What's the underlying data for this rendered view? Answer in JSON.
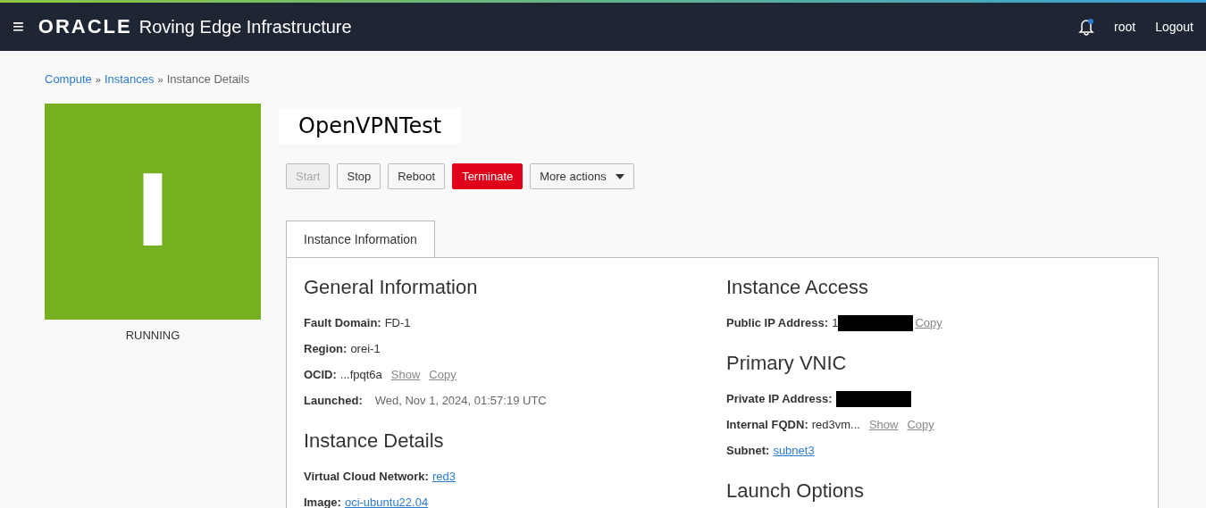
{
  "header": {
    "menu_glyph": "≡",
    "brand": "ORACLE",
    "product": "Roving Edge Infrastructure",
    "notification_unread": true,
    "user": "root",
    "logout": "Logout"
  },
  "breadcrumbs": [
    {
      "label": "Compute",
      "kind": "link"
    },
    {
      "label": "Instances",
      "kind": "link"
    },
    {
      "label": "Instance Details",
      "kind": "current"
    }
  ],
  "breadcrumb_separator": "»",
  "status": {
    "letter": "I",
    "label": "RUNNING",
    "color": "#76b021"
  },
  "title": "OpenVPNTest",
  "actions": [
    {
      "label": "Start",
      "kind": "default",
      "disabled": true
    },
    {
      "label": "Stop",
      "kind": "default",
      "disabled": false
    },
    {
      "label": "Reboot",
      "kind": "default",
      "disabled": false
    },
    {
      "label": "Terminate",
      "kind": "danger",
      "disabled": false
    },
    {
      "label": "More actions",
      "kind": "menu",
      "disabled": false
    }
  ],
  "tabs": [
    {
      "label": "Instance Information",
      "selected": true
    }
  ],
  "columns": [
    {
      "sections": [
        {
          "heading": "General Information",
          "fields": [
            {
              "label": "Fault Domain:",
              "value": "FD-1",
              "kind": "text"
            },
            {
              "label": "Region:",
              "value": "orei-1",
              "kind": "text"
            },
            {
              "label": "OCID:",
              "value": "...fpqt6a",
              "kind": "text",
              "actions": [
                "Show",
                "Copy"
              ]
            },
            {
              "label": "Launched:",
              "value": "Wed, Nov 1, 2024, 01:57:19 UTC",
              "kind": "muted"
            }
          ]
        },
        {
          "heading": "Instance Details",
          "fields": [
            {
              "label": "Virtual Cloud Network:",
              "value": "red3",
              "kind": "link"
            },
            {
              "label": "Image:",
              "value": "oci-ubuntu22.04",
              "kind": "link"
            }
          ]
        }
      ]
    },
    {
      "sections": [
        {
          "heading": "Instance Access",
          "fields": [
            {
              "label": "Public IP Address:",
              "value": "1",
              "kind": "text",
              "redacted": true,
              "actions": [
                "Copy"
              ]
            }
          ]
        },
        {
          "heading": "Primary VNIC",
          "fields": [
            {
              "label": "Private IP Address:",
              "redacted": true
            },
            {
              "label": "Internal FQDN:",
              "value": "red3vm...",
              "kind": "text",
              "actions": [
                "Show",
                "Copy"
              ]
            },
            {
              "label": "Subnet:",
              "value": "subnet3",
              "kind": "link"
            }
          ]
        },
        {
          "heading": "Launch Options"
        }
      ]
    }
  ]
}
